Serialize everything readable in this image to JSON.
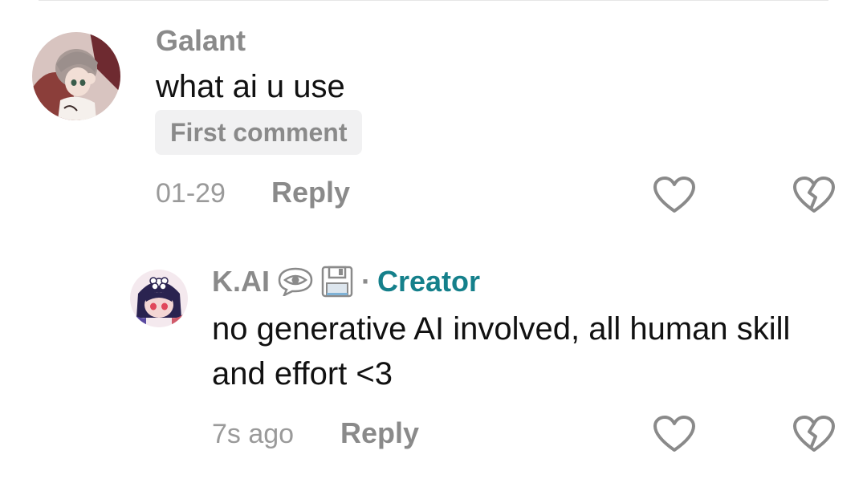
{
  "comments": [
    {
      "username": "Galant",
      "text": "what ai u use",
      "badge": "First comment",
      "time": "01-29",
      "reply_label": "Reply"
    }
  ],
  "replies": [
    {
      "username": "K.AI",
      "creator_separator": "·",
      "creator_label": "Creator",
      "text": "no generative AI involved, all human skill and effort <3",
      "time": "7s ago",
      "reply_label": "Reply"
    }
  ],
  "icons": {
    "like": "heart-outline-icon",
    "dislike": "broken-heart-outline-icon",
    "name_emojis": [
      "eye-in-speech-bubble-icon",
      "floppy-disk-icon"
    ]
  },
  "colors": {
    "creator_accent": "#15808b",
    "muted_text": "#8a8a8a",
    "body_text": "#111111",
    "badge_background": "#f1f1f2"
  }
}
